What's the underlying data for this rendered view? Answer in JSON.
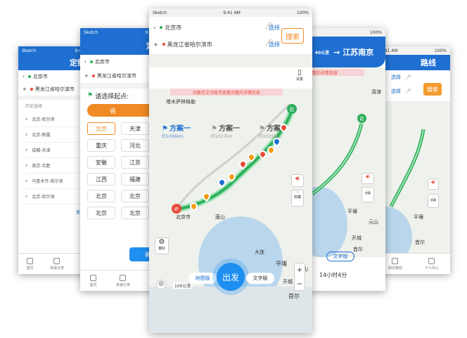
{
  "p1": {
    "status": {
      "carrier": "Sketch",
      "time": "9:41 AM"
    },
    "title": "定制路",
    "origin": "北京市",
    "dest": "黑龙江省哈尔滨市",
    "history_title": "历史选择",
    "history": [
      "北京-哈尔滨",
      "北京-新疆",
      "成都-天津",
      "南京-合肥",
      "乌鲁木齐-哈尔滨",
      "北京-哈尔滨"
    ],
    "more": "查看全部",
    "tabs": [
      "首页",
      "高速分类",
      "路线"
    ]
  },
  "p2": {
    "status": {
      "carrier": "Sketch",
      "time": "9:41 AM"
    },
    "title": "定制",
    "origin": "北京市",
    "dest": "黑龙江省哈尔滨市",
    "prompt": "请选择起点:",
    "seg": "省",
    "cities": [
      "北京",
      "天津",
      "",
      "重庆",
      "河北",
      "山",
      "安徽",
      "江苏",
      "浙",
      "江西",
      "福建",
      "广",
      "北京",
      "北京",
      "北",
      "北京",
      "北京",
      "北"
    ],
    "confirm": "确",
    "tabs": [
      "首页",
      "高速分类",
      "路线"
    ]
  },
  "p3": {
    "status": {
      "carrier": "Sketch",
      "time": "9:41 AM",
      "battery": "100%"
    },
    "origin": "北京市",
    "dest": "黑龙江省哈尔滨市",
    "choose": "选择",
    "search": "搜索",
    "plans": [
      {
        "name": "方案一",
        "dist": "约1006km"
      },
      {
        "name": "方案一",
        "dist": "约1027km"
      },
      {
        "name": "方案一",
        "dist": "约1025km"
      }
    ],
    "settings": "设置",
    "banner": "切换至文字版可查看完整的详情信息",
    "map_labels": {
      "a": "塔木萨林格勒",
      "b": "平壤",
      "c": "首尔",
      "d": "元山",
      "e": "开城",
      "f": "北京市",
      "g": "唐山",
      "h": "大连"
    },
    "start": "起",
    "end": "终",
    "btn_pref": "偏好",
    "btn_collect": "收藏",
    "view_map": "地图版",
    "go": "出发",
    "view_text": "文字版",
    "scale": "100公里"
  },
  "p4": {
    "status": {
      "time": "9:41 AM",
      "battery": "100%"
    },
    "dist": "40公里",
    "next_road": "江苏南京",
    "banner": "完整的详情信息",
    "map_labels": {
      "a": "平壤",
      "b": "首尔",
      "c": "元山",
      "d": "开城",
      "e": "清津"
    },
    "start": "起",
    "collect": "收藏",
    "view_text": "文字版",
    "duration": "14小时4分"
  },
  "p5": {
    "status": {
      "time": "9:41 AM",
      "battery": "100%"
    },
    "title": "路线",
    "choose": "选择",
    "search": "搜索",
    "labels": {
      "a": "平壤",
      "b": "首尔"
    },
    "collect": "收藏",
    "tabs": [
      "制定路线",
      "个人中心"
    ]
  }
}
